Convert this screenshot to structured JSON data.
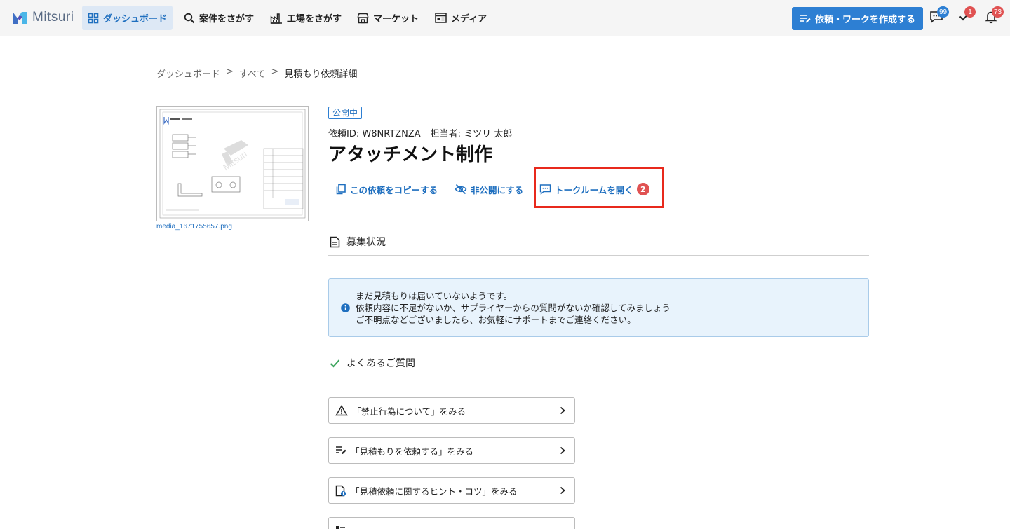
{
  "header": {
    "logo_text": "Mitsuri",
    "nav": [
      {
        "label": "ダッシュボード",
        "icon": "grid-icon",
        "active": true
      },
      {
        "label": "案件をさがす",
        "icon": "search-icon"
      },
      {
        "label": "工場をさがす",
        "icon": "factory-icon"
      },
      {
        "label": "マーケット",
        "icon": "store-icon"
      },
      {
        "label": "メディア",
        "icon": "newspaper-icon"
      }
    ],
    "create_button": "依頼・ワークを作成する",
    "badges": {
      "messages": "99",
      "tasks": "1",
      "notifications": "73"
    }
  },
  "breadcrumb": {
    "items": [
      "ダッシュボード",
      "すべて",
      "見積もり依頼詳細"
    ],
    "separator": ">"
  },
  "attachment": {
    "filename": "media_1671755657.png"
  },
  "request": {
    "status": "公開中",
    "request_id": "依頼ID: W8NRTZNZA",
    "assignee": "担当者: ミツリ 太郎",
    "title": "アタッチメント制作"
  },
  "actions": {
    "copy": "この依頼をコピーする",
    "unpublish": "非公開にする",
    "open_talk": "トークルームを開く",
    "talk_count": "2"
  },
  "recruitment": {
    "heading": "募集状況",
    "notice": [
      "まだ見積もりは届いていないようです。",
      "依頼内容に不足がないか、サプライヤーからの質問がないか確認してみましょう",
      "ご不明点などございましたら、お気軽にサポートまでご連絡ください。"
    ]
  },
  "faq": {
    "heading": "よくあるご質問",
    "items": [
      {
        "label": "「禁止行為について」をみる",
        "icon": "warning-icon"
      },
      {
        "label": "「見積もりを依頼する」をみる",
        "icon": "request-list-icon"
      },
      {
        "label": "「見積依頼に関するヒント・コツ」をみる",
        "icon": "document-tip-icon"
      }
    ]
  },
  "colors": {
    "accent": "#2d7fd3",
    "highlight": "#e8291c",
    "info_bg": "#e8f3fc",
    "badge_red": "#e05252"
  }
}
